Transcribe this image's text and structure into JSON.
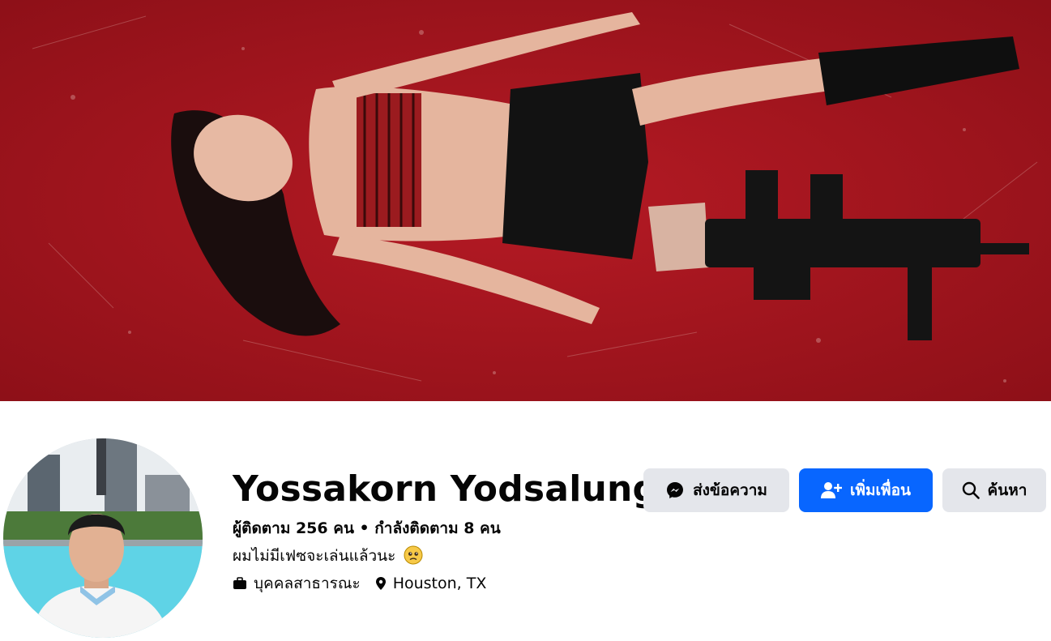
{
  "cover": {
    "description_icon": "cover-photo",
    "color": "#a3141e"
  },
  "profile": {
    "name": "Yossakorn Yodsalung",
    "stats": "ผู้ติดตาม 256 คน • กำลังติดตาม 8 คน",
    "bio": "ผมไม่มีเฟซจะเล่นแล้วนะ",
    "bio_emoji": "pleading-face",
    "details": [
      {
        "icon": "briefcase-icon",
        "text": "บุคคลสาธารณะ"
      },
      {
        "icon": "location-pin-icon",
        "text": "Houston, TX"
      }
    ]
  },
  "actions": {
    "message_label": "ส่งข้อความ",
    "add_friend_label": "เพิ่มเพื่อน",
    "search_label": "ค้นหา"
  },
  "colors": {
    "primary_button": "#0866ff",
    "secondary_button": "#e4e6eb",
    "text": "#050505"
  }
}
